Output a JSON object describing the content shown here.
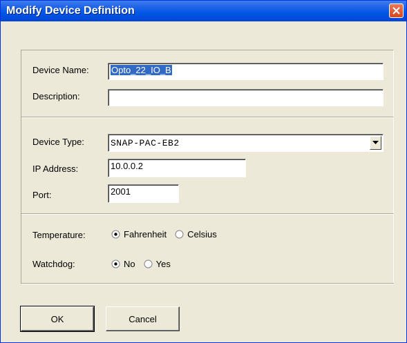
{
  "window": {
    "title": "Modify Device Definition"
  },
  "identity": {
    "device_name_label": "Device Name:",
    "device_name_value": "Opto_22_IO_B",
    "description_label": "Description:",
    "description_value": ""
  },
  "connection": {
    "device_type_label": "Device Type:",
    "device_type_value": "SNAP-PAC-EB2",
    "ip_label": "IP Address:",
    "ip_value": "10.0.0.2",
    "port_label": "Port:",
    "port_value": "2001"
  },
  "options": {
    "temperature_label": "Temperature:",
    "temperature_options": [
      "Fahrenheit",
      "Celsius"
    ],
    "temperature_selected": "Fahrenheit",
    "watchdog_label": "Watchdog:",
    "watchdog_options": [
      "No",
      "Yes"
    ],
    "watchdog_selected": "No"
  },
  "buttons": {
    "ok_label": "OK",
    "cancel_label": "Cancel"
  },
  "colors": {
    "titlebar": "#0055E5",
    "close_button": "#D8451E",
    "selection": "#316AC5",
    "dialog_background": "#ECE9D8"
  },
  "icons": {
    "close": "close-icon",
    "dropdown": "chevron-down-icon",
    "radio": "radio-icon"
  }
}
